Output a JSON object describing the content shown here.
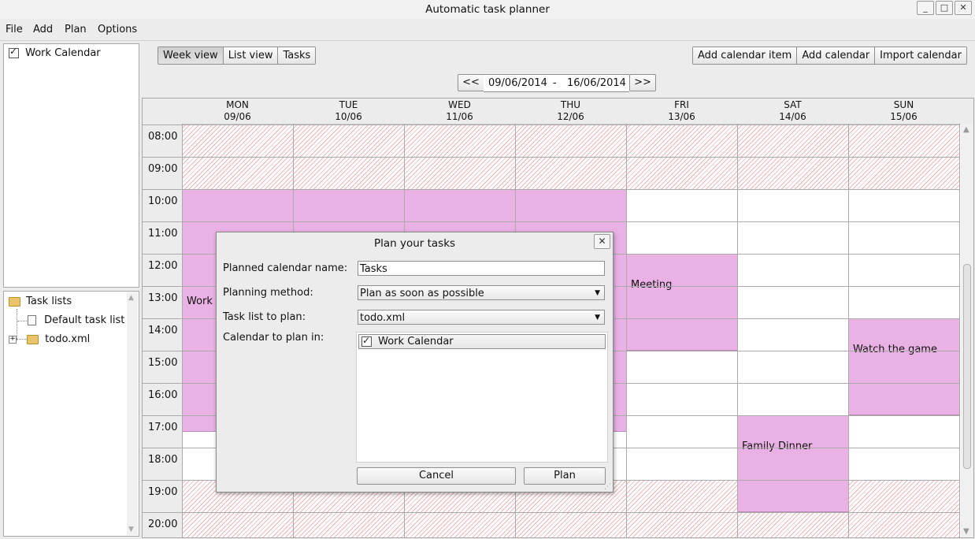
{
  "window": {
    "title": "Automatic task planner",
    "minimize": "_",
    "maximize": "□",
    "close": "✕"
  },
  "menu": [
    "File",
    "Add",
    "Plan",
    "Options"
  ],
  "calendars": [
    {
      "label": "Work Calendar",
      "checked": true
    }
  ],
  "task_tree": {
    "root": "Task lists",
    "children": [
      {
        "label": "Default task list"
      },
      {
        "label": "todo.xml",
        "expandable": true
      }
    ]
  },
  "view_tabs": [
    {
      "label": "Week view",
      "active": true
    },
    {
      "label": "List view"
    },
    {
      "label": "Tasks"
    }
  ],
  "actions": [
    "Add calendar item",
    "Add calendar",
    "Import calendar"
  ],
  "date_range": {
    "prev": "<<",
    "next": ">>",
    "start": "09/06/2014",
    "sep": "-",
    "end": "16/06/2014"
  },
  "days": [
    {
      "name": "MON",
      "date": "09/06"
    },
    {
      "name": "TUE",
      "date": "10/06"
    },
    {
      "name": "WED",
      "date": "11/06"
    },
    {
      "name": "THU",
      "date": "12/06"
    },
    {
      "name": "FRI",
      "date": "13/06"
    },
    {
      "name": "SAT",
      "date": "14/06"
    },
    {
      "name": "SUN",
      "date": "15/06"
    }
  ],
  "hours": [
    "08:00",
    "09:00",
    "10:00",
    "11:00",
    "12:00",
    "13:00",
    "14:00",
    "15:00",
    "16:00",
    "17:00",
    "18:00",
    "19:00",
    "20:00"
  ],
  "events": [
    {
      "title": "Work",
      "day": 0,
      "start": "09:00",
      "end": "16:30",
      "label_time": "12:30"
    },
    {
      "title": "",
      "day": 1,
      "start": "09:00",
      "end": "16:30"
    },
    {
      "title": "",
      "day": 2,
      "start": "09:00",
      "end": "16:30"
    },
    {
      "title": "",
      "day": 3,
      "start": "09:00",
      "end": "16:30"
    },
    {
      "title": "Meeting",
      "day": 4,
      "start": "11:00",
      "end": "14:00",
      "label_time": "12:00"
    },
    {
      "title": "Family Dinner",
      "day": 5,
      "start": "16:00",
      "end": "19:00",
      "label_time": "17:00"
    },
    {
      "title": "Watch the game",
      "day": 6,
      "start": "13:00",
      "end": "16:00",
      "label_time": "14:00"
    }
  ],
  "dialog": {
    "title": "Plan your tasks",
    "close": "✕",
    "fields": {
      "calendar_name_label": "Planned calendar name:",
      "calendar_name_value": "Tasks",
      "method_label": "Planning method:",
      "method_value": "Plan as soon as possible",
      "tasklist_label": "Task list to plan:",
      "tasklist_value": "todo.xml",
      "calendar_label": "Calendar to plan in:",
      "calendar_item": "Work Calendar"
    },
    "cancel": "Cancel",
    "plan": "Plan"
  },
  "colors": {
    "event": "#eab1e4",
    "hatch": "#e9b7b7"
  }
}
